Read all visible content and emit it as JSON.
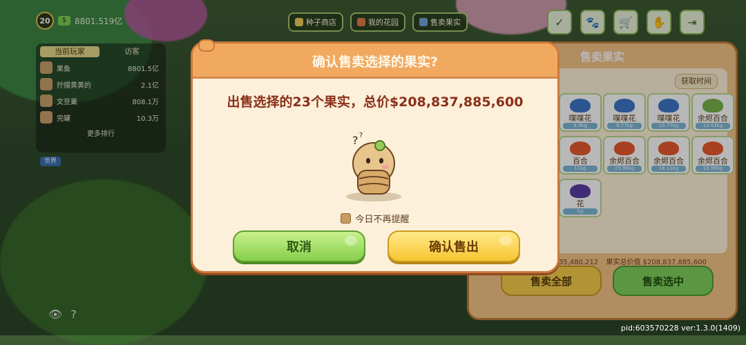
{
  "hud": {
    "level": "20",
    "money": "8801.519亿"
  },
  "topnav": [
    {
      "label": "种子商店"
    },
    {
      "label": "我的花园"
    },
    {
      "label": "售卖果实"
    }
  ],
  "ranking": {
    "tabs": [
      "当前玩家",
      "访客"
    ],
    "rows": [
      {
        "name": "果鱼",
        "value": "8801.5亿"
      },
      {
        "name": "拧摆黄黄的",
        "value": "2.1亿"
      },
      {
        "name": "文豆巢",
        "value": "808.1万"
      },
      {
        "name": "完罐",
        "value": "10.3万"
      }
    ],
    "more": "更多排行",
    "world": "世界"
  },
  "sell_panel": {
    "title": "售卖果实",
    "sort": "获取时间",
    "items": [
      {
        "name": "喋喋花",
        "weight": "9.9kg"
      },
      {
        "name": "喋喋花",
        "weight": "9.77kg"
      },
      {
        "name": "喋喋花",
        "weight": "15.77kg"
      },
      {
        "name": "余烬百合",
        "weight": "13.03kg"
      },
      {
        "name": "百合",
        "weight": "11kg"
      },
      {
        "name": "余烬百合",
        "weight": "15.98kg"
      },
      {
        "name": "余烬百合",
        "weight": "18.11kg"
      },
      {
        "name": "余烬百合",
        "weight": "18.99kg"
      },
      {
        "name": "花",
        "weight": "kg"
      }
    ],
    "left_total": "35,480,212",
    "total_label": "果实总价值",
    "total_value": "208,837,885,600",
    "sell_all": "售卖全部",
    "sell_selected": "售卖选中"
  },
  "modal": {
    "title": "确认售卖选择的果实?",
    "message": "出售选择的23个果实，总价$208,837,885,600",
    "checkbox_label": "今日不再提醒",
    "cancel": "取消",
    "confirm": "确认售出"
  },
  "footer": {
    "pid": "pid:603570228 ver:1.3.0(1409)"
  },
  "colors": {
    "accent": "#f1a95f",
    "modal_bg": "#fdf0db",
    "message": "#8a2f18",
    "cancel_green": "#86cf4b",
    "confirm_yellow": "#f6c532"
  }
}
